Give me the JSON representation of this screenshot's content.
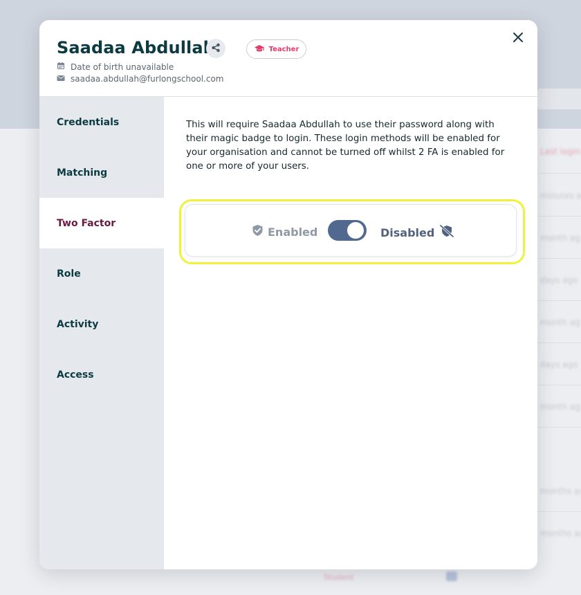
{
  "profile": {
    "name": "Saadaa Abdullah",
    "role": "Teacher",
    "dob": "Date of birth unavailable",
    "email": "saadaa.abdullah@furlongschool.com"
  },
  "nav": {
    "items": [
      {
        "label": "Credentials"
      },
      {
        "label": "Matching"
      },
      {
        "label": "Two Factor",
        "active": true
      },
      {
        "label": "Role"
      },
      {
        "label": "Activity"
      },
      {
        "label": "Access"
      }
    ]
  },
  "two_factor": {
    "description": "This will require Saadaa Abdullah to use their password along with their magic badge to login. These login methods will be enabled for your organisation and cannot be turned off whilst 2 FA is enabled for one or more of your users.",
    "enabled_label": "Enabled",
    "disabled_label": "Disabled",
    "state": "disabled"
  },
  "background": {
    "column_header": "Last login",
    "times": [
      "minutes ag",
      "month ag",
      "days ago",
      "month ag",
      "days ago",
      "month ag",
      "months ag",
      "months ag"
    ],
    "bottom_role": "Student"
  },
  "colors": {
    "brand_dark": "#0b3b40",
    "accent_pink": "#e23c6a",
    "active_nav": "#6a1b43",
    "toggle_track": "#52698f",
    "highlight": "#f0f23a"
  },
  "icons": {
    "share": "share-icon",
    "role": "graduation-cap-icon",
    "dob": "calendar-icon",
    "email": "envelope-icon",
    "close": "close-icon",
    "enabled": "shield-check-icon",
    "disabled": "shield-slash-icon"
  }
}
